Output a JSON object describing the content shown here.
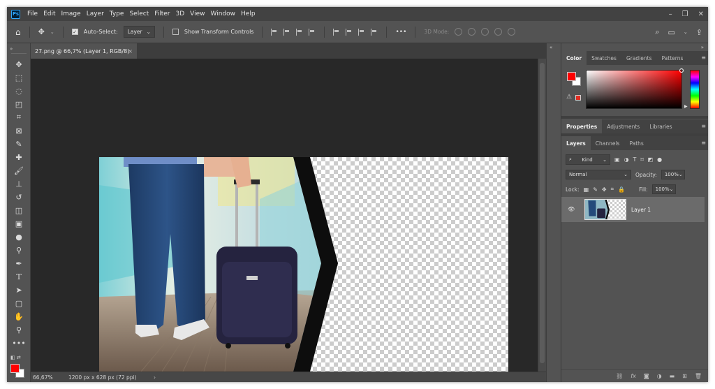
{
  "app": {
    "logo": "Ps"
  },
  "menu": [
    "File",
    "Edit",
    "Image",
    "Layer",
    "Type",
    "Select",
    "Filter",
    "3D",
    "View",
    "Window",
    "Help"
  ],
  "window_controls": {
    "minimize": "–",
    "restore": "❐",
    "close": "✕"
  },
  "options": {
    "auto_select_label": "Auto-Select:",
    "auto_select_checked": true,
    "auto_select_target": "Layer",
    "show_transform_label": "Show Transform Controls",
    "more": "•••",
    "mode_3d": "3D Mode:"
  },
  "document": {
    "tab_title": "27.png @ 66,7% (Layer 1, RGB/8)",
    "close": "×"
  },
  "status": {
    "zoom": "66,67%",
    "doc_info": "1200 px x 628 px (72 ppi)",
    "arrow": "›"
  },
  "color_panel": {
    "tabs": [
      "Color",
      "Swatches",
      "Gradients",
      "Patterns"
    ],
    "active_tab": "Color",
    "foreground": "#ff0000",
    "background": "#ffffff"
  },
  "properties_panel": {
    "tabs": [
      "Properties",
      "Adjustments",
      "Libraries"
    ],
    "active_tab": "Properties"
  },
  "layers_panel": {
    "tabs": [
      "Layers",
      "Channels",
      "Paths"
    ],
    "active_tab": "Layers",
    "filter_kind": "Kind",
    "blend_mode": "Normal",
    "opacity_label": "Opacity:",
    "opacity_value": "100%",
    "lock_label": "Lock:",
    "fill_label": "Fill:",
    "fill_value": "100%",
    "layers": [
      {
        "name": "Layer 1",
        "visible": true,
        "selected": true
      }
    ]
  },
  "colors": {
    "ui_dark": "#535353",
    "canvas_bg": "#282828",
    "accent_red": "#ff0000"
  }
}
